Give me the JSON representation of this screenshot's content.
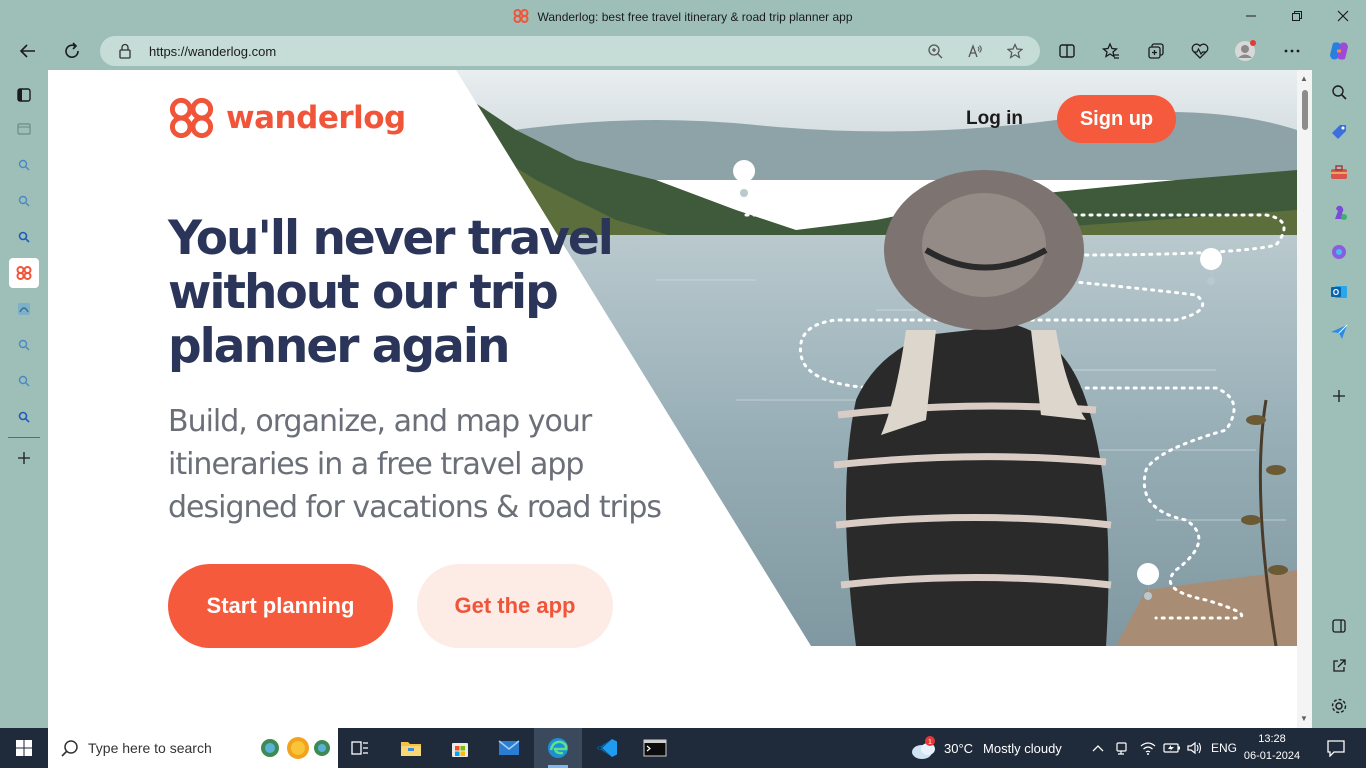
{
  "window": {
    "title": "Wanderlog: best free travel itinerary & road trip planner app"
  },
  "toolbar": {
    "url": "https://wanderlog.com"
  },
  "page": {
    "logo_text": "wanderlog",
    "login": "Log in",
    "signup": "Sign up",
    "headline": "You'll never travel without our trip planner again",
    "subline": "Build, organize, and map your itineraries in a free travel app designed for vacations & road trips",
    "cta_primary": "Start planning",
    "cta_secondary": "Get the app"
  },
  "taskbar": {
    "search_placeholder": "Type here to search",
    "weather_temp": "30°C",
    "weather_desc": "Mostly cloudy",
    "weather_badge": "1",
    "language": "ENG",
    "time": "13:28",
    "date": "06-01-2024"
  },
  "colors": {
    "brand": "#f55a3c",
    "headline": "#2a3559",
    "chrome": "#9ebfb8",
    "taskbar": "#1f2a3a"
  }
}
